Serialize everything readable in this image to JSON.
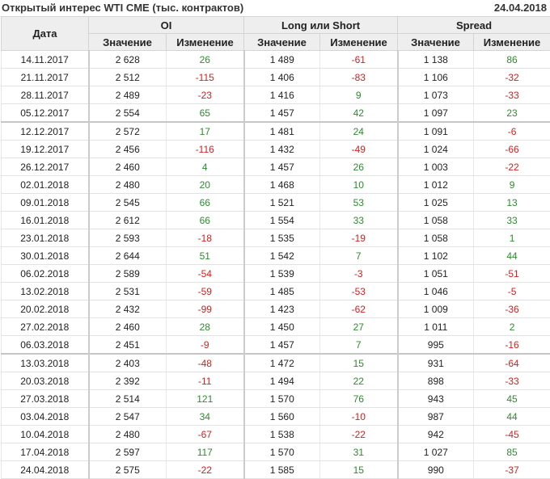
{
  "header": {
    "title": "Открытый интерес WTI CME (тыс. контрактов)",
    "date": "24.04.2018"
  },
  "table": {
    "col_date": "Дата",
    "groups": [
      "OI",
      "Long или Short",
      "Spread"
    ],
    "sub_value": "Значение",
    "sub_change": "Изменение",
    "rows": [
      {
        "date": "14.11.2017",
        "oi": "2 628",
        "oi_chg": "26",
        "ls": "1 489",
        "ls_chg": "-61",
        "sp": "1 138",
        "sp_chg": "86"
      },
      {
        "date": "21.11.2017",
        "oi": "2 512",
        "oi_chg": "-115",
        "ls": "1 406",
        "ls_chg": "-83",
        "sp": "1 106",
        "sp_chg": "-32"
      },
      {
        "date": "28.11.2017",
        "oi": "2 489",
        "oi_chg": "-23",
        "ls": "1 416",
        "ls_chg": "9",
        "sp": "1 073",
        "sp_chg": "-33"
      },
      {
        "date": "05.12.2017",
        "oi": "2 554",
        "oi_chg": "65",
        "ls": "1 457",
        "ls_chg": "42",
        "sp": "1 097",
        "sp_chg": "23"
      },
      {
        "date": "12.12.2017",
        "oi": "2 572",
        "oi_chg": "17",
        "ls": "1 481",
        "ls_chg": "24",
        "sp": "1 091",
        "sp_chg": "-6"
      },
      {
        "date": "19.12.2017",
        "oi": "2 456",
        "oi_chg": "-116",
        "ls": "1 432",
        "ls_chg": "-49",
        "sp": "1 024",
        "sp_chg": "-66"
      },
      {
        "date": "26.12.2017",
        "oi": "2 460",
        "oi_chg": "4",
        "ls": "1 457",
        "ls_chg": "26",
        "sp": "1 003",
        "sp_chg": "-22"
      },
      {
        "date": "02.01.2018",
        "oi": "2 480",
        "oi_chg": "20",
        "ls": "1 468",
        "ls_chg": "10",
        "sp": "1 012",
        "sp_chg": "9"
      },
      {
        "date": "09.01.2018",
        "oi": "2 545",
        "oi_chg": "66",
        "ls": "1 521",
        "ls_chg": "53",
        "sp": "1 025",
        "sp_chg": "13"
      },
      {
        "date": "16.01.2018",
        "oi": "2 612",
        "oi_chg": "66",
        "ls": "1 554",
        "ls_chg": "33",
        "sp": "1 058",
        "sp_chg": "33"
      },
      {
        "date": "23.01.2018",
        "oi": "2 593",
        "oi_chg": "-18",
        "ls": "1 535",
        "ls_chg": "-19",
        "sp": "1 058",
        "sp_chg": "1"
      },
      {
        "date": "30.01.2018",
        "oi": "2 644",
        "oi_chg": "51",
        "ls": "1 542",
        "ls_chg": "7",
        "sp": "1 102",
        "sp_chg": "44"
      },
      {
        "date": "06.02.2018",
        "oi": "2 589",
        "oi_chg": "-54",
        "ls": "1 539",
        "ls_chg": "-3",
        "sp": "1 051",
        "sp_chg": "-51"
      },
      {
        "date": "13.02.2018",
        "oi": "2 531",
        "oi_chg": "-59",
        "ls": "1 485",
        "ls_chg": "-53",
        "sp": "1 046",
        "sp_chg": "-5"
      },
      {
        "date": "20.02.2018",
        "oi": "2 432",
        "oi_chg": "-99",
        "ls": "1 423",
        "ls_chg": "-62",
        "sp": "1 009",
        "sp_chg": "-36"
      },
      {
        "date": "27.02.2018",
        "oi": "2 460",
        "oi_chg": "28",
        "ls": "1 450",
        "ls_chg": "27",
        "sp": "1 011",
        "sp_chg": "2"
      },
      {
        "date": "06.03.2018",
        "oi": "2 451",
        "oi_chg": "-9",
        "ls": "1 457",
        "ls_chg": "7",
        "sp": "995",
        "sp_chg": "-16"
      },
      {
        "date": "13.03.2018",
        "oi": "2 403",
        "oi_chg": "-48",
        "ls": "1 472",
        "ls_chg": "15",
        "sp": "931",
        "sp_chg": "-64"
      },
      {
        "date": "20.03.2018",
        "oi": "2 392",
        "oi_chg": "-11",
        "ls": "1 494",
        "ls_chg": "22",
        "sp": "898",
        "sp_chg": "-33"
      },
      {
        "date": "27.03.2018",
        "oi": "2 514",
        "oi_chg": "121",
        "ls": "1 570",
        "ls_chg": "76",
        "sp": "943",
        "sp_chg": "45"
      },
      {
        "date": "03.04.2018",
        "oi": "2 547",
        "oi_chg": "34",
        "ls": "1 560",
        "ls_chg": "-10",
        "sp": "987",
        "sp_chg": "44"
      },
      {
        "date": "10.04.2018",
        "oi": "2 480",
        "oi_chg": "-67",
        "ls": "1 538",
        "ls_chg": "-22",
        "sp": "942",
        "sp_chg": "-45"
      },
      {
        "date": "17.04.2018",
        "oi": "2 597",
        "oi_chg": "117",
        "ls": "1 570",
        "ls_chg": "31",
        "sp": "1 027",
        "sp_chg": "85"
      },
      {
        "date": "24.04.2018",
        "oi": "2 575",
        "oi_chg": "-22",
        "ls": "1 585",
        "ls_chg": "15",
        "sp": "990",
        "sp_chg": "-37"
      }
    ]
  },
  "colors": {
    "positive": "#2e8b2e",
    "negative": "#d42020",
    "header_bg": "#eeeeee"
  }
}
